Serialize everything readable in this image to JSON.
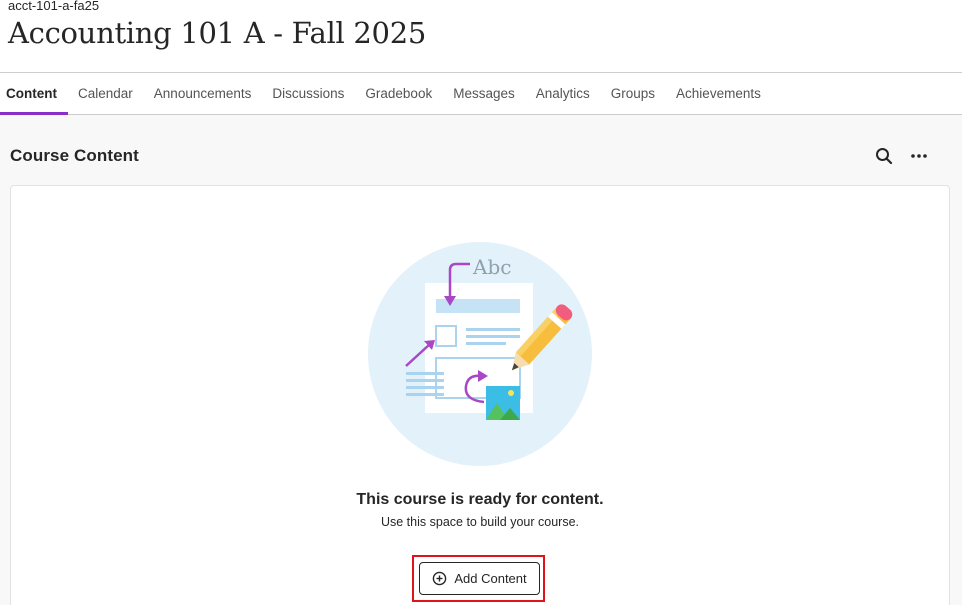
{
  "course": {
    "code": "acct-101-a-fa25",
    "title": "Accounting 101 A - Fall 2025"
  },
  "nav": {
    "tabs": [
      {
        "label": "Content",
        "active": true
      },
      {
        "label": "Calendar",
        "active": false
      },
      {
        "label": "Announcements",
        "active": false
      },
      {
        "label": "Discussions",
        "active": false
      },
      {
        "label": "Gradebook",
        "active": false
      },
      {
        "label": "Messages",
        "active": false
      },
      {
        "label": "Analytics",
        "active": false
      },
      {
        "label": "Groups",
        "active": false
      },
      {
        "label": "Achievements",
        "active": false
      }
    ],
    "active_color": "#8b2fc9"
  },
  "main": {
    "section_title": "Course Content",
    "search_icon": "search-icon",
    "more_icon": "more-horizontal-icon",
    "empty_state": {
      "illustration_text": "Abc",
      "title": "This course is ready for content.",
      "subtitle": "Use this space to build your course.",
      "button_label": "Add Content",
      "button_icon": "plus-circle-icon"
    }
  },
  "colors": {
    "accent": "#8b2fc9",
    "highlight": "#e0121b",
    "illustration_bg": "#e3f1fa"
  }
}
